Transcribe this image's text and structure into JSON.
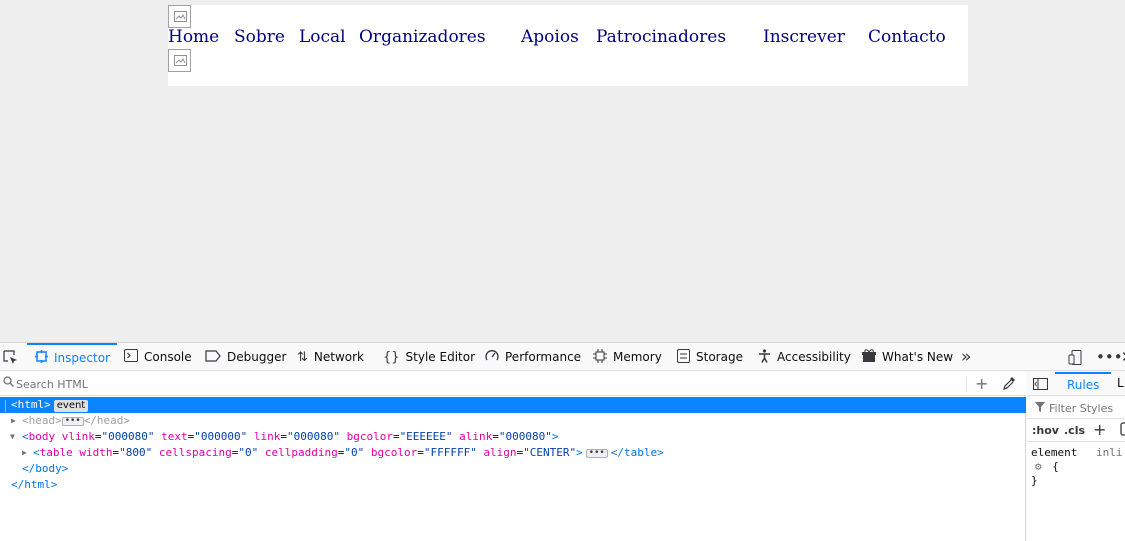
{
  "page": {
    "nav_links": [
      "Home",
      "Sobre",
      "Local",
      "Organizadores",
      "Apoios",
      "Patrocinadores",
      "Inscrever",
      "Contacto"
    ],
    "colors": {
      "page_bg": "#EEEEEE",
      "table_bg": "#FFFFFF",
      "link": "#000080"
    }
  },
  "devtools": {
    "tabs": [
      {
        "label": "Inspector",
        "icon": "inspector-icon",
        "selected": true
      },
      {
        "label": "Console",
        "icon": "console-icon"
      },
      {
        "label": "Debugger",
        "icon": "debugger-icon"
      },
      {
        "label": "Network",
        "icon": "network-icon"
      },
      {
        "label": "Style Editor",
        "icon": "style-editor-icon"
      },
      {
        "label": "Performance",
        "icon": "performance-icon"
      },
      {
        "label": "Memory",
        "icon": "memory-icon"
      },
      {
        "label": "Storage",
        "icon": "storage-icon"
      },
      {
        "label": "Accessibility",
        "icon": "accessibility-icon"
      },
      {
        "label": "What's New",
        "icon": "whats-new-icon"
      }
    ],
    "search_placeholder": "Search HTML",
    "tree": {
      "html_open": "<html>",
      "event_badge": "event",
      "head_open": "<head>",
      "head_close": "</head>",
      "body_tag": "body",
      "body_attrs": [
        {
          "name": "vlink",
          "value": "\"000080\""
        },
        {
          "name": "text",
          "value": "\"000000\""
        },
        {
          "name": "link",
          "value": "\"000080\""
        },
        {
          "name": "bgcolor",
          "value": "\"EEEEEE\""
        },
        {
          "name": "alink",
          "value": "\"000080\""
        }
      ],
      "table_tag": "table",
      "table_attrs": [
        {
          "name": "width",
          "value": "\"800\""
        },
        {
          "name": "cellspacing",
          "value": "\"0\""
        },
        {
          "name": "cellpadding",
          "value": "\"0\""
        },
        {
          "name": "bgcolor",
          "value": "\"FFFFFF\""
        },
        {
          "name": "align",
          "value": "\"CENTER\""
        }
      ],
      "table_close": "</table>",
      "body_close": "</body>",
      "html_close": "</html>"
    },
    "sidebar": {
      "tabs": [
        "Rules",
        "L"
      ],
      "filter_placeholder": "Filter Styles",
      "hov_label": ":hov",
      "cls_label": ".cls",
      "element_label": "element",
      "inline_label": "inli",
      "open_brace": "{",
      "close_brace": "}"
    },
    "accent": "#0a84ff"
  }
}
